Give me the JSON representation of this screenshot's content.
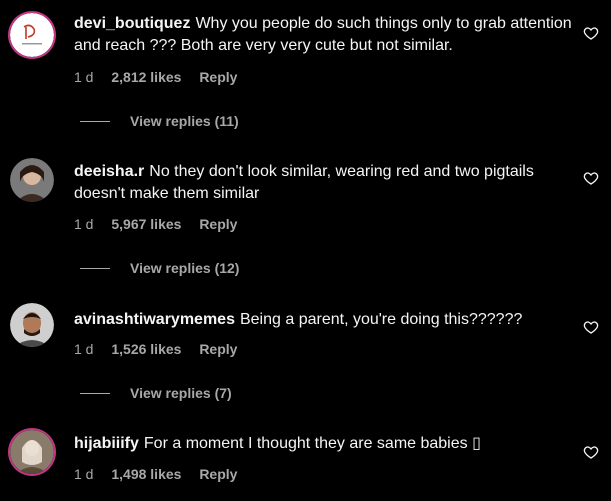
{
  "comments": [
    {
      "username": "devi_boutiquez",
      "text": "Why you people do such things only to grab attention and reach ??? Both are very very cute but not similar.",
      "time": "1 d",
      "likes": "2,812 likes",
      "reply_label": "Reply",
      "view_replies": "View replies (11)"
    },
    {
      "username": "deeisha.r",
      "text": "No they don't look similar, wearing red and two pigtails doesn't make them similar",
      "time": "1 d",
      "likes": "5,967 likes",
      "reply_label": "Reply",
      "view_replies": "View replies (12)"
    },
    {
      "username": "avinashtiwarymemes",
      "text": "Being a parent, you're doing this??????",
      "time": "1 d",
      "likes": "1,526 likes",
      "reply_label": "Reply",
      "view_replies": "View replies (7)"
    },
    {
      "username": "hijabiiify",
      "text": "For a moment I thought they are same babies ▯",
      "time": "1 d",
      "likes": "1,498 likes",
      "reply_label": "Reply"
    }
  ],
  "icons": {
    "like": "heart-icon"
  },
  "colors": {
    "background": "#000000",
    "text": "#f5f5f5",
    "secondary": "#a8a8a8",
    "story_ring": "#c13584"
  }
}
